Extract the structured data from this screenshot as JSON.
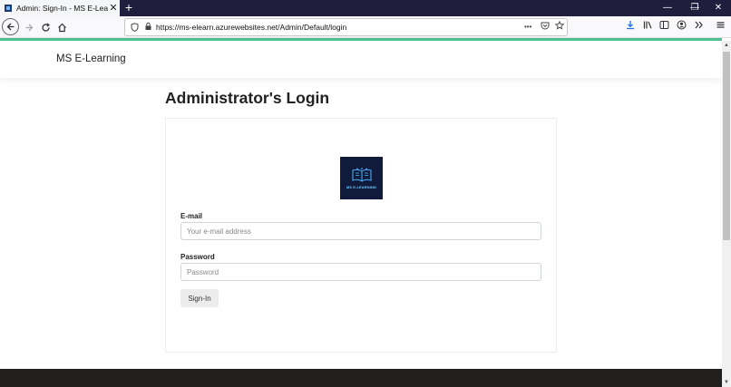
{
  "browser": {
    "tab_title": "Admin: Sign-In - MS E-Learning",
    "tab_close": "✕",
    "new_tab": "+",
    "url": "https://ms-elearn.azurewebsites.net/Admin/Default/login",
    "url_more": "•••",
    "window_controls": {
      "minimize": "—",
      "restore": "❐",
      "close": "✕"
    }
  },
  "site": {
    "brand": "MS E-Learning"
  },
  "login": {
    "title": "Administrator's Login",
    "logo_text": "MS E-LEARNING",
    "email_label": "E-mail",
    "email_placeholder": "Your e-mail address",
    "email_value": "",
    "password_label": "Password",
    "password_placeholder": "Password",
    "password_value": "",
    "submit_label": "Sign-In"
  },
  "colors": {
    "accent_line": "#4fc08d",
    "tab_strip": "#1f1e3d",
    "footer": "#231f1f",
    "logo_bg": "#101a3a"
  }
}
